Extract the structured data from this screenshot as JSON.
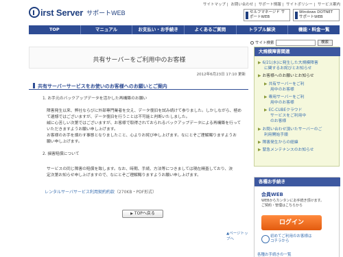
{
  "header": {
    "logo_text": "irst Server",
    "logo_sub": "サポートWEB",
    "top_links": [
      "サイトマップ",
      "お問い合わせ",
      "サポート情報",
      "サイトポリシー",
      "サービス案内"
    ],
    "badge_one": "セルフマネージド サポートWEB",
    "badge_two": "Windows DOTNET サポートWEB"
  },
  "nav": {
    "items": [
      "TOP",
      "マニュアル",
      "お支払い・お手続き",
      "よくあるご質問",
      "トラブル解決",
      "機能・料金一覧"
    ]
  },
  "search": {
    "label": "サイト検索",
    "button": "検索"
  },
  "main": {
    "title": "共有サーバーをご利用中のお客様",
    "date": "2012年6月23日 17:10 更新",
    "section_heading": "共有サーバーサービスをお使いのお客様へのお願いとご案内",
    "item1_heading": "1. お手元のバックアップデータを活かした再構築のお願い",
    "para1": [
      "障害発生以来、弊社ならびに外部専門業者を交え、データ復旧を試み続けて参りました。しかしながら、極め",
      "て遺憾ではございますが、データ復旧を行うことは不可能と判断いたしました。",
      "誠に心苦しい次第ではございますが、お客様で取得されておられるバックアップデータによる再構築を行って",
      "いただきますようお願い申し上げます。",
      "お客様のお手を煩わす事態となりましたこと、心よりお詫び申し上げます。なにとぞご理解賜りますようお",
      "願い申し上げます。"
    ],
    "item2_heading": "2. 損害賠償について",
    "para2": [
      "サービスの同じ障害の賠償を致します。なお、時期、手続、方法等につきましては現在精査しており、決",
      "定次第お知らせ申し上げますので、なにとぞご理解賜りますようお願い申し上げます。"
    ],
    "link_text": "レンタルサーバサービス利用契約約款",
    "link_size": "（270KB・PDF形式）",
    "back_button": "TOPへ戻る",
    "page_top": "ページトップへ"
  },
  "sidebar": {
    "heading": "大規模障害関連",
    "items": [
      "6/21(水)に発生した大規模障害",
      "に関するお詫びとお知らせ",
      "お客様へのお願いとお知らせ"
    ],
    "sub_items": [
      "共有サーバーをご利",
      "用中のお客様",
      "専用サーバーをご利",
      "用中のお客様",
      "EC-CUBEクラウド",
      "サービスをご利用中",
      "のお客様"
    ],
    "more_items": [
      "お問い合わせ頂いたサーバーのご",
      "利用開始手順",
      "障害発生からの経緯",
      "緊急メンテナンスのお知らせ"
    ],
    "proc_heading": "各種お手続き",
    "proc_logo": "会員WEB",
    "proc_desc": [
      "WEBからカンタンにお手続き頂けます。",
      "ご契約・管理はこちらから"
    ],
    "login": "ログイン",
    "first_time": [
      "初めてご利用のお客様は",
      "コチラから"
    ],
    "more_proc": "各種お手続きの一覧"
  },
  "colors": {
    "nav_bg": "#2e4c94",
    "side_bg": "#f5f8dc",
    "login": "#f07020"
  }
}
